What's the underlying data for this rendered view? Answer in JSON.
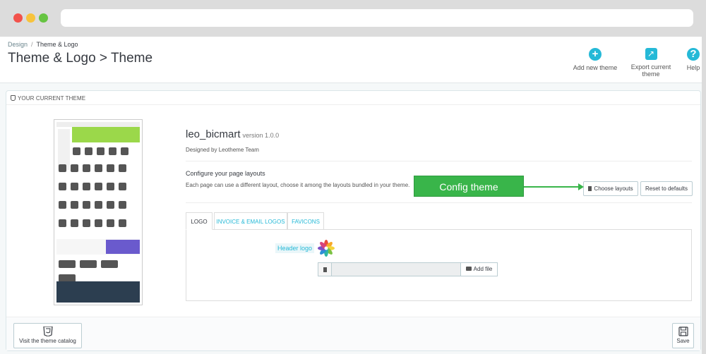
{
  "breadcrumb": {
    "parent": "Design",
    "current": "Theme & Logo"
  },
  "page_title": "Theme & Logo > Theme",
  "toolbar": {
    "add_new_theme": "Add new theme",
    "export_current_theme": "Export current theme",
    "help": "Help"
  },
  "panel": {
    "heading": "YOUR CURRENT THEME"
  },
  "theme": {
    "name": "leo_bicmart",
    "version": "version 1.0.0",
    "author": "Designed by Leotheme Team",
    "configure_title": "Configure your page layouts",
    "configure_desc": "Each page can use a different layout, choose it among the layouts bundled in your theme."
  },
  "buttons": {
    "choose_layouts": "Choose layouts",
    "reset_defaults": "Reset to defaults",
    "add_file": "Add file",
    "visit_catalog": "Visit the theme catalog",
    "save": "Save"
  },
  "callout": "Config theme",
  "tabs": [
    {
      "label": "LOGO"
    },
    {
      "label": "INVOICE & EMAIL LOGOS"
    },
    {
      "label": "FAVICONS"
    }
  ],
  "logo_form": {
    "header_logo_label": "Header logo"
  },
  "colors": {
    "accent": "#25b9d7",
    "callout": "#39b54a"
  }
}
